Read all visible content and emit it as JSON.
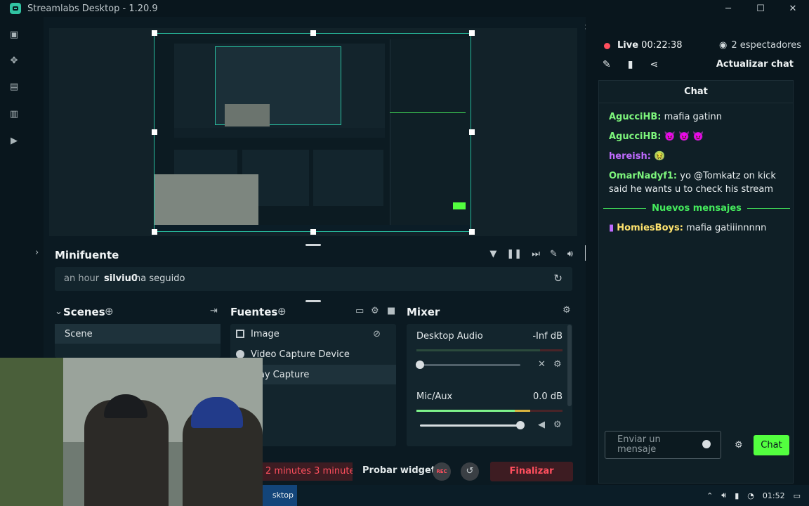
{
  "window": {
    "title": "Streamlabs Desktop - 1.20.9"
  },
  "nav": {
    "icons": [
      "studio-icon",
      "themes-icon",
      "store-icon",
      "layout-icon",
      "highlighter-icon"
    ]
  },
  "minifuente": {
    "title": "Minifuente",
    "event_time": "an hour",
    "event_user": "silviu0",
    "event_action": "ha seguido"
  },
  "scenes": {
    "title": "Scenes",
    "items": [
      "Scene"
    ]
  },
  "sources": {
    "title": "Fuentes",
    "items": [
      "Image",
      "Video Capture Device",
      "play Capture"
    ]
  },
  "mixer": {
    "title": "Mixer",
    "channels": [
      {
        "name": "Desktop Audio",
        "level": "-Inf dB",
        "volume": 0.0
      },
      {
        "name": "Mic/Aux",
        "level": "0.0 dB",
        "volume": 1.0
      }
    ]
  },
  "footer": {
    "alert": "2 minutes 3 minutes a",
    "test_widgets": "Probar widgets",
    "rec": "REC",
    "end_stream": "Finalizar stream"
  },
  "live": {
    "label": "Live",
    "duration": "00:22:38",
    "viewers": "2 espectadores",
    "update_chat": "Actualizar chat"
  },
  "chat": {
    "title": "Chat",
    "messages": [
      {
        "user": "AgucciHB",
        "text": "mafia gatinn",
        "color": "#7df57c"
      },
      {
        "user": "AgucciHB",
        "text": "👿 👿 👿",
        "color": "#7df57c"
      },
      {
        "user": "hereish",
        "text": "🤢",
        "color": "#c06bff"
      },
      {
        "user": "OmarNadyf1",
        "text": "yo @Tomkatz on kick said he wants u to check his stream",
        "color": "#7df57c"
      },
      {
        "user": "HomiesBoys",
        "text": "mafia gatiiinnnnn",
        "color": "#ffe36e"
      }
    ],
    "new_messages": "Nuevos mensajes",
    "input_placeholder": "Enviar un mensaje",
    "send_label": "Chat"
  },
  "taskbar": {
    "app_label": "sktop",
    "time": "01:52"
  },
  "colors": {
    "accent": "#28bfa0",
    "live": "#ff4f5e",
    "green": "#53ff3f"
  }
}
